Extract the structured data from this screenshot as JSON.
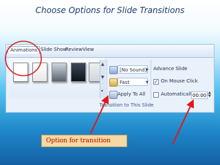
{
  "slide": {
    "title": "Choose Options for Slide Transitions",
    "callout": "Option for transition"
  },
  "ribbon": {
    "tabs": [
      "Animations",
      "Slide Show",
      "Review",
      "View"
    ],
    "active_tab": "Animations",
    "sound_value": "[No Sound]",
    "speed_value": "Fast",
    "apply_all_label": "Apply To All",
    "advance_heading": "Advance Slide",
    "on_mouse_click_label": "On Mouse Click",
    "on_mouse_click_checked": true,
    "auto_after_label": "Automatically After:",
    "auto_after_checked": false,
    "auto_after_value": "00:00",
    "group_label": "Transition to This Slide"
  },
  "colors": {
    "highlight_circle": "#d62020",
    "arrow": "#e01818",
    "callout_bg": "#f6d9a3",
    "callout_text": "#b40000"
  },
  "icons": [
    "sound-icon",
    "speed-icon",
    "apply-all-icon",
    "gallery-scroll-up",
    "gallery-scroll-down",
    "gallery-more",
    "time-spinner"
  ]
}
